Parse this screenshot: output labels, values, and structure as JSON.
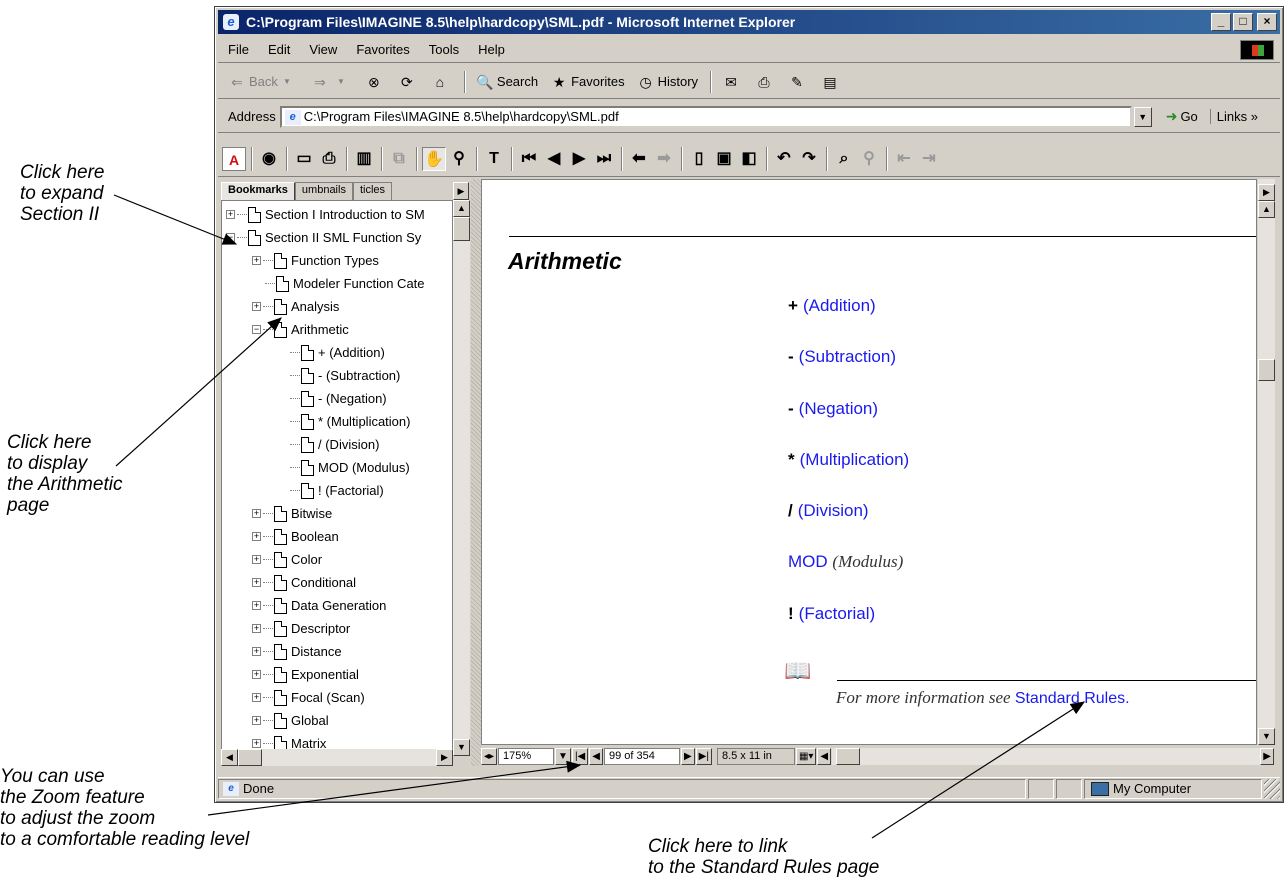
{
  "callouts": {
    "expand": "Click here\nto expand\nSection II",
    "display": "Click here\nto display\nthe Arithmetic\npage",
    "zoom": "You can use\nthe Zoom feature\nto adjust the zoom\nto a comfortable reading level",
    "link": "Click here to link\nto the Standard Rules page"
  },
  "window": {
    "title": "C:\\Program Files\\IMAGINE 8.5\\help\\hardcopy\\SML.pdf - Microsoft Internet Explorer",
    "min": "_",
    "max": "□",
    "close": "×"
  },
  "menu": [
    "File",
    "Edit",
    "View",
    "Favorites",
    "Tools",
    "Help"
  ],
  "toolbar": {
    "back": "Back",
    "search": "Search",
    "favorites": "Favorites",
    "history": "History"
  },
  "address": {
    "label": "Address",
    "value": "C:\\Program Files\\IMAGINE 8.5\\help\\hardcopy\\SML.pdf",
    "go": "Go",
    "links": "Links »"
  },
  "nav": {
    "tabs": [
      "Bookmarks",
      "umbnails",
      "ticles"
    ],
    "items": [
      {
        "label": "Section I Introduction to SM",
        "expander": "+"
      },
      {
        "label": "Section II SML Function Sy",
        "expander": "−"
      },
      {
        "label": "Function Types",
        "expander": "+"
      },
      {
        "label": "Modeler Function Cate",
        "expander": ""
      },
      {
        "label": "Analysis",
        "expander": "+"
      },
      {
        "label": "Arithmetic",
        "expander": "−"
      },
      {
        "label": "+ (Addition)",
        "expander": ""
      },
      {
        "label": "- (Subtraction)",
        "expander": ""
      },
      {
        "label": "- (Negation)",
        "expander": ""
      },
      {
        "label": "* (Multiplication)",
        "expander": ""
      },
      {
        "label": "/ (Division)",
        "expander": ""
      },
      {
        "label": "MOD (Modulus)",
        "expander": ""
      },
      {
        "label": "! (Factorial)",
        "expander": ""
      },
      {
        "label": "Bitwise",
        "expander": "+"
      },
      {
        "label": "Boolean",
        "expander": "+"
      },
      {
        "label": "Color",
        "expander": "+"
      },
      {
        "label": "Conditional",
        "expander": "+"
      },
      {
        "label": "Data Generation",
        "expander": "+"
      },
      {
        "label": "Descriptor",
        "expander": "+"
      },
      {
        "label": "Distance",
        "expander": "+"
      },
      {
        "label": "Exponential",
        "expander": "+"
      },
      {
        "label": "Focal (Scan)",
        "expander": "+"
      },
      {
        "label": "Global",
        "expander": "+"
      },
      {
        "label": "Matrix",
        "expander": "+"
      }
    ]
  },
  "doc": {
    "heading": "Arithmetic",
    "ops": [
      {
        "sym": "+",
        "text": "(Addition)",
        "style": "link"
      },
      {
        "sym": "-",
        "text": "(Subtraction)",
        "style": "link"
      },
      {
        "sym": "-",
        "text": "(Negation)",
        "style": "link"
      },
      {
        "sym": "*",
        "text": "(Multiplication)",
        "style": "link"
      },
      {
        "sym": "/",
        "text": "(Division)",
        "style": "link"
      },
      {
        "sym": "",
        "text": "MOD",
        "extra": "(Modulus)",
        "style": "mod"
      },
      {
        "sym": "!",
        "text": "(Factorial)",
        "style": "link"
      }
    ],
    "note_prefix": "For more information see ",
    "note_link": "Standard Rules."
  },
  "docstatus": {
    "zoom": "175%",
    "page": "99 of 354",
    "size": "8.5 x 11 in"
  },
  "status": {
    "text": "Done",
    "zone": "My Computer"
  },
  "colors": {
    "link": "#1a1aee",
    "titlebar": "#0a246a"
  }
}
